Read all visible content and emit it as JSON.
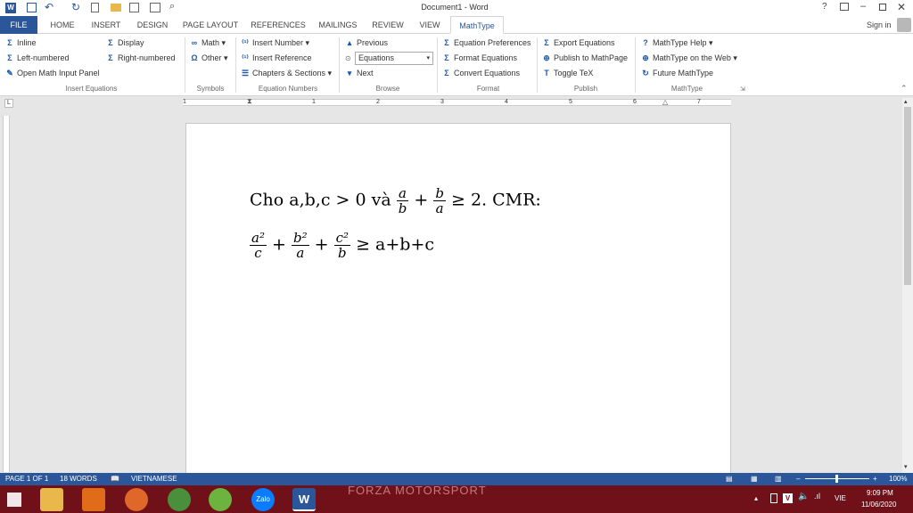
{
  "window": {
    "title": "Document1 - Word",
    "sign_in": "Sign in"
  },
  "tabs": [
    {
      "label": "FILE"
    },
    {
      "label": "HOME"
    },
    {
      "label": "INSERT"
    },
    {
      "label": "DESIGN"
    },
    {
      "label": "PAGE LAYOUT"
    },
    {
      "label": "REFERENCES"
    },
    {
      "label": "MAILINGS"
    },
    {
      "label": "REVIEW"
    },
    {
      "label": "VIEW"
    },
    {
      "label": "MathType"
    }
  ],
  "ribbon": {
    "insert_equations": {
      "inline": "Inline",
      "display": "Display",
      "left_numbered": "Left-numbered",
      "right_numbered": "Right-numbered",
      "open_panel": "Open Math Input Panel",
      "group": "Insert Equations"
    },
    "symbols": {
      "math": "Math",
      "other": "Other",
      "group": "Symbols"
    },
    "equation_numbers": {
      "insert_number": "Insert Number",
      "insert_reference": "Insert Reference",
      "chapters": "Chapters & Sections",
      "group": "Equation Numbers"
    },
    "browse": {
      "previous": "Previous",
      "select_value": "Equations",
      "next": "Next",
      "group": "Browse"
    },
    "format": {
      "preferences": "Equation Preferences",
      "format_eq": "Format Equations",
      "convert": "Convert Equations",
      "group": "Format"
    },
    "publish": {
      "export": "Export Equations",
      "publish_page": "Publish to MathPage",
      "toggle_tex": "Toggle TeX",
      "group": "Publish"
    },
    "mathtype": {
      "help": "MathType Help",
      "web": "MathType on the Web",
      "future": "Future MathType",
      "group": "MathType"
    }
  },
  "ruler": {
    "ticks": [
      "1",
      "1",
      "2",
      "3",
      "4",
      "5",
      "6",
      "7"
    ]
  },
  "document": {
    "line1_prefix": "Cho a,b,c > 0 và",
    "frac1_num": "a",
    "frac1_den": "b",
    "plus": "+",
    "frac2_num": "b",
    "frac2_den": "a",
    "line1_suffix": "≥ 2. CMR:",
    "line2": {
      "f1_num": "a²",
      "f1_den": "c",
      "f2_num": "b²",
      "f2_den": "a",
      "f3_num": "c²",
      "f3_den": "b",
      "rhs": "≥ a+b+c"
    }
  },
  "status": {
    "page": "PAGE 1 OF 1",
    "words": "18 WORDS",
    "language": "VIETNAMESE",
    "zoom": "100%"
  },
  "taskbar": {
    "banner": "FORZA MOTORSPORT",
    "lang": "VIE",
    "time": "9:09 PM",
    "date": "11/06/2020",
    "zalo": "Zalo"
  },
  "colors": {
    "accent": "#2b579a",
    "taskbar": "#701019"
  }
}
